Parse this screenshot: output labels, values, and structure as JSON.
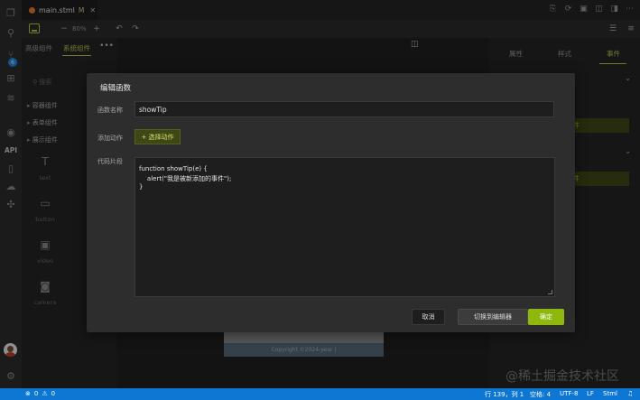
{
  "editor": {
    "tab_title": "main.stml",
    "tab_modified": "M",
    "zoom": "80%"
  },
  "left_panel": {
    "tabs": [
      "高级组件",
      "系统组件"
    ],
    "search_placeholder": "搜索",
    "groups": [
      "容器组件",
      "表单组件",
      "展示组件"
    ],
    "components": [
      "text",
      "button",
      "video",
      "camera"
    ]
  },
  "right_panel": {
    "tabs": [
      "属性",
      "样式",
      "事件"
    ],
    "bar_suffix": "件"
  },
  "canvas": {
    "footer_text": "Copyright ©2024-year |"
  },
  "modal": {
    "title": "编辑函数",
    "name_label": "函数名称",
    "name_value": "showTip",
    "action_label": "添加动作",
    "add_action_button": "+ 选择动作",
    "code_label": "代码片段",
    "code_lines": [
      "function showTip(e) {",
      "    alert(\"我是被新添加的事件\");",
      "}"
    ],
    "cancel_button": "取消",
    "switch_button": "切换到编辑器",
    "ok_button": "确定"
  },
  "statusbar": {
    "errors": "0",
    "warnings": "0",
    "position": "行 139，列 1",
    "spaces": "空格: 4",
    "encoding": "UTF-8",
    "eol": "LF",
    "language": "Stml"
  },
  "activity_bar": {
    "api_label": "API",
    "scm_badge": "6"
  },
  "watermark": "@稀土掘金技术社区",
  "colors": {
    "accent": "#b9c44a",
    "ok_button": "#8fb80f",
    "statusbar": "#0e76d3"
  }
}
